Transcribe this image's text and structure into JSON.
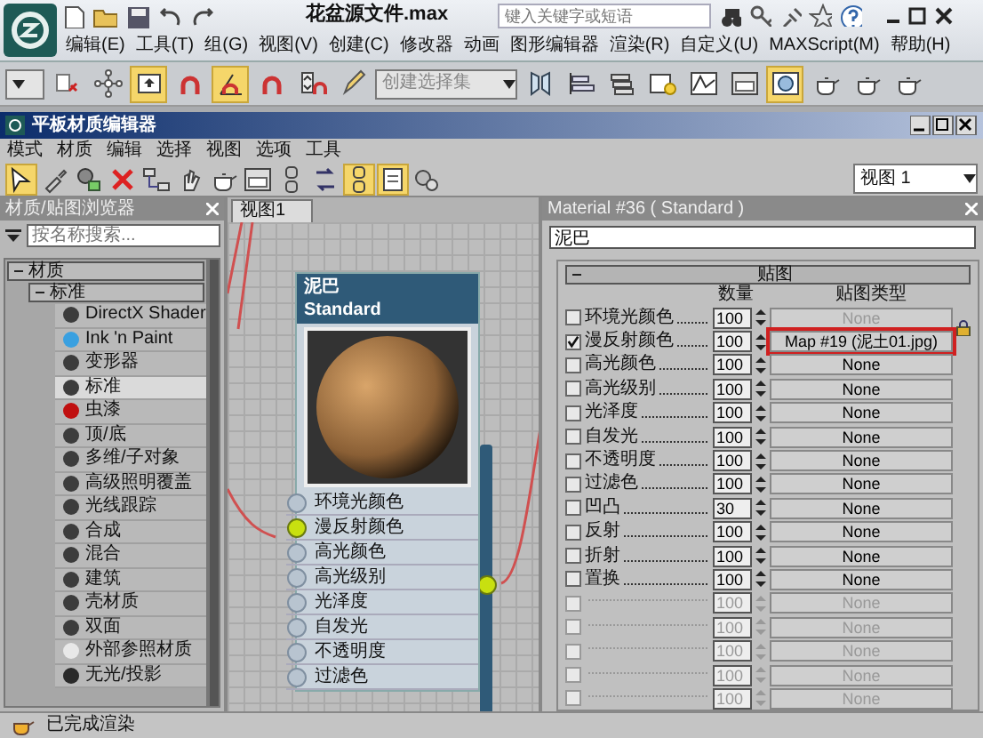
{
  "app": {
    "title": "花盆源文件.max",
    "search": {
      "placeholder": "键入关键字或短语"
    },
    "menu": [
      "编辑(E)",
      "工具(T)",
      "组(G)",
      "视图(V)",
      "创建(C)",
      "修改器",
      "动画",
      "图形编辑器",
      "渲染(R)",
      "自定义(U)",
      "MAXScript(M)",
      "帮助(H)"
    ]
  },
  "main_toolbar": {
    "buttons": [
      {
        "on": false
      },
      {
        "on": false
      },
      {
        "on": true
      },
      {
        "on": false
      },
      {
        "on": true
      },
      {
        "on": false
      },
      {
        "on": false
      },
      {
        "on": false
      }
    ],
    "selection_set": {
      "placeholder": "创建选择集"
    },
    "buttons_right": [
      {
        "on": false
      },
      {
        "on": false
      },
      {
        "on": false
      },
      {
        "on": false
      },
      {
        "on": false
      },
      {
        "on": false
      },
      {
        "on": true
      },
      {
        "on": false
      },
      {
        "on": false
      },
      {
        "on": false
      }
    ]
  },
  "editor": {
    "title": "平板材质编辑器",
    "menu": [
      "模式",
      "材质",
      "编辑",
      "选择",
      "视图",
      "选项",
      "工具"
    ],
    "toolbar": [
      {
        "on": true
      },
      {
        "on": false
      },
      {
        "on": false
      },
      {
        "on": false
      },
      {
        "on": false
      },
      {
        "on": false
      },
      {
        "on": false
      },
      {
        "on": false
      },
      {
        "on": false
      },
      {
        "on": false
      },
      {
        "on": true
      },
      {
        "on": true
      },
      {
        "on": false
      }
    ],
    "view_select": {
      "value": "视图 1"
    }
  },
  "browser": {
    "title": "材质/贴图浏览器",
    "search": {
      "placeholder": "按名称搜索..."
    },
    "groups": [
      {
        "label": "材质",
        "expanded": true,
        "children": [
          {
            "label": "标准",
            "expanded": true,
            "children": [
              {
                "label": "DirectX Shader",
                "color": "#3c3c3c",
                "selected": false
              },
              {
                "label": "Ink 'n Paint",
                "color": "#3aa0e0",
                "selected": false
              },
              {
                "label": "变形器",
                "color": "#3c3c3c",
                "selected": false
              },
              {
                "label": "标准",
                "color": "#3c3c3c",
                "selected": true
              },
              {
                "label": "虫漆",
                "color": "#c01010",
                "selected": false
              },
              {
                "label": "顶/底",
                "color": "#3c3c3c",
                "selected": false
              },
              {
                "label": "多维/子对象",
                "color": "#3c3c3c",
                "selected": false
              },
              {
                "label": "高级照明覆盖",
                "color": "#3c3c3c",
                "selected": false
              },
              {
                "label": "光线跟踪",
                "color": "#3c3c3c",
                "selected": false
              },
              {
                "label": "合成",
                "color": "#3c3c3c",
                "selected": false
              },
              {
                "label": "混合",
                "color": "#3c3c3c",
                "selected": false
              },
              {
                "label": "建筑",
                "color": "#3c3c3c",
                "selected": false
              },
              {
                "label": "壳材质",
                "color": "#3c3c3c",
                "selected": false
              },
              {
                "label": "双面",
                "color": "#3c3c3c",
                "selected": false
              },
              {
                "label": "外部参照材质",
                "color": "#e8e8e8",
                "selected": false
              },
              {
                "label": "无光/投影",
                "color": "#2a2a2a",
                "selected": false
              }
            ]
          }
        ]
      }
    ]
  },
  "view_tab": {
    "label": "视图1",
    "selected": true
  },
  "node": {
    "name": "泥巴",
    "type": "Standard",
    "slots": [
      {
        "label": "环境光颜色",
        "connected": false
      },
      {
        "label": "漫反射颜色",
        "connected": true
      },
      {
        "label": "高光颜色",
        "connected": false
      },
      {
        "label": "高光级别",
        "connected": false
      },
      {
        "label": "光泽度",
        "connected": false
      },
      {
        "label": "自发光",
        "connected": false
      },
      {
        "label": "不透明度",
        "connected": false
      },
      {
        "label": "过滤色",
        "connected": false
      }
    ]
  },
  "params": {
    "title": "Material #36  ( Standard )",
    "name": "泥巴",
    "rollout": {
      "label": "贴图",
      "expanded": true
    },
    "columns": [
      "数量",
      "贴图类型"
    ],
    "rows": [
      {
        "label": "环境光颜色",
        "checked": false,
        "amount": "100",
        "map": "None",
        "locked": true,
        "highlighted": false,
        "disabled": false
      },
      {
        "label": "漫反射颜色",
        "checked": true,
        "amount": "100",
        "map": "Map #19 (泥土01.jpg)",
        "locked": false,
        "highlighted": true,
        "disabled": false
      },
      {
        "label": "高光颜色",
        "checked": false,
        "amount": "100",
        "map": "None",
        "locked": false,
        "highlighted": false,
        "disabled": false
      },
      {
        "label": "高光级别",
        "checked": false,
        "amount": "100",
        "map": "None",
        "locked": false,
        "highlighted": false,
        "disabled": false
      },
      {
        "label": "光泽度",
        "checked": false,
        "amount": "100",
        "map": "None",
        "locked": false,
        "highlighted": false,
        "disabled": false
      },
      {
        "label": "自发光",
        "checked": false,
        "amount": "100",
        "map": "None",
        "locked": false,
        "highlighted": false,
        "disabled": false
      },
      {
        "label": "不透明度",
        "checked": false,
        "amount": "100",
        "map": "None",
        "locked": false,
        "highlighted": false,
        "disabled": false
      },
      {
        "label": "过滤色",
        "checked": false,
        "amount": "100",
        "map": "None",
        "locked": false,
        "highlighted": false,
        "disabled": false
      },
      {
        "label": "凹凸",
        "checked": false,
        "amount": "30",
        "map": "None",
        "locked": false,
        "highlighted": false,
        "disabled": false
      },
      {
        "label": "反射",
        "checked": false,
        "amount": "100",
        "map": "None",
        "locked": false,
        "highlighted": false,
        "disabled": false
      },
      {
        "label": "折射",
        "checked": false,
        "amount": "100",
        "map": "None",
        "locked": false,
        "highlighted": false,
        "disabled": false
      },
      {
        "label": "置换",
        "checked": false,
        "amount": "100",
        "map": "None",
        "locked": false,
        "highlighted": false,
        "disabled": false
      },
      {
        "checked": false,
        "amount": "100",
        "map": "None",
        "locked": false,
        "highlighted": false,
        "disabled": true
      },
      {
        "checked": false,
        "amount": "100",
        "map": "None",
        "locked": false,
        "highlighted": false,
        "disabled": true
      },
      {
        "checked": false,
        "amount": "100",
        "map": "None",
        "locked": false,
        "highlighted": false,
        "disabled": true
      },
      {
        "checked": false,
        "amount": "100",
        "map": "None",
        "locked": false,
        "highlighted": false,
        "disabled": true
      },
      {
        "checked": false,
        "amount": "100",
        "map": "None",
        "locked": false,
        "highlighted": false,
        "disabled": true
      }
    ]
  },
  "status_bar": {
    "text": "已完成渲染"
  }
}
